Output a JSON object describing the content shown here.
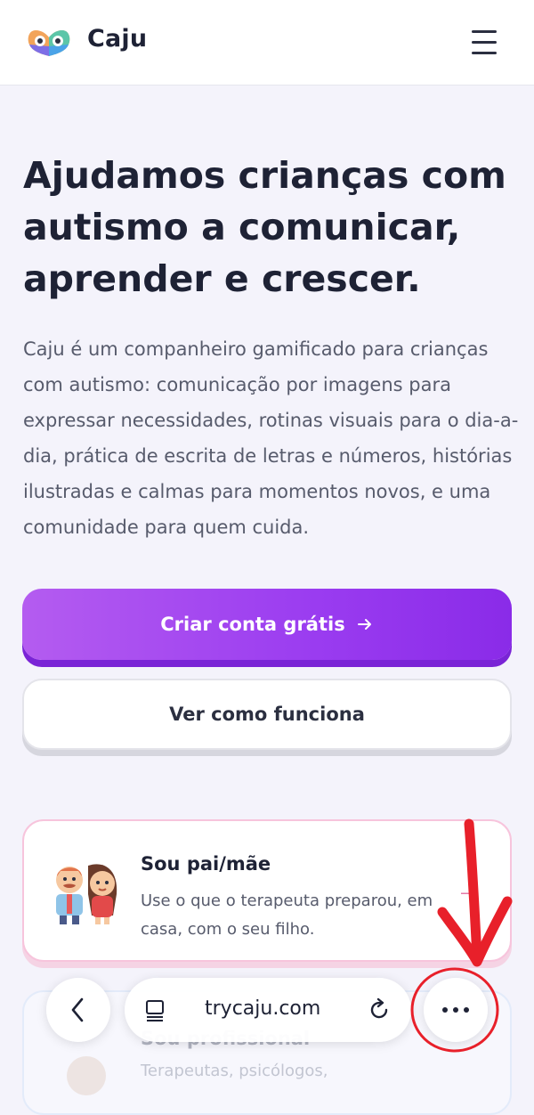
{
  "header": {
    "brand": "Caju",
    "logo_icon": "caju-logo-icon",
    "menu_icon": "hamburger-menu-icon"
  },
  "hero": {
    "title": "Ajudamos crianças com autismo a comunicar, aprender e crescer.",
    "description": "Caju é um companheiro gamificado para crianças com autismo: comunicação por imagens para expressar necessidades, rotinas visuais para o dia-a-dia, prática de escrita de letras e números, histórias ilustradas e calmas para momentos novos, e uma comunidade para quem cuida."
  },
  "actions": {
    "primary_label": "Criar conta grátis",
    "primary_icon": "arrow-right-icon",
    "secondary_label": "Ver como funciona"
  },
  "cards": [
    {
      "title": "Sou pai/mãe",
      "description": "Use o que o terapeuta preparou, em casa, com o seu filho.",
      "icon": "parents-illustration-icon"
    },
    {
      "title": "Sou profissional",
      "description": "Terapeutas, psicólogos,"
    }
  ],
  "browser": {
    "url": "trycaju.com",
    "back_icon": "chevron-left-icon",
    "tabs_icon": "tab-overview-icon",
    "reload_icon": "reload-icon",
    "more_icon": "more-options-icon"
  },
  "colors": {
    "primary_button": "#9a3cf0",
    "annotation": "#e8202a",
    "card_border": "#f7c4dc"
  }
}
